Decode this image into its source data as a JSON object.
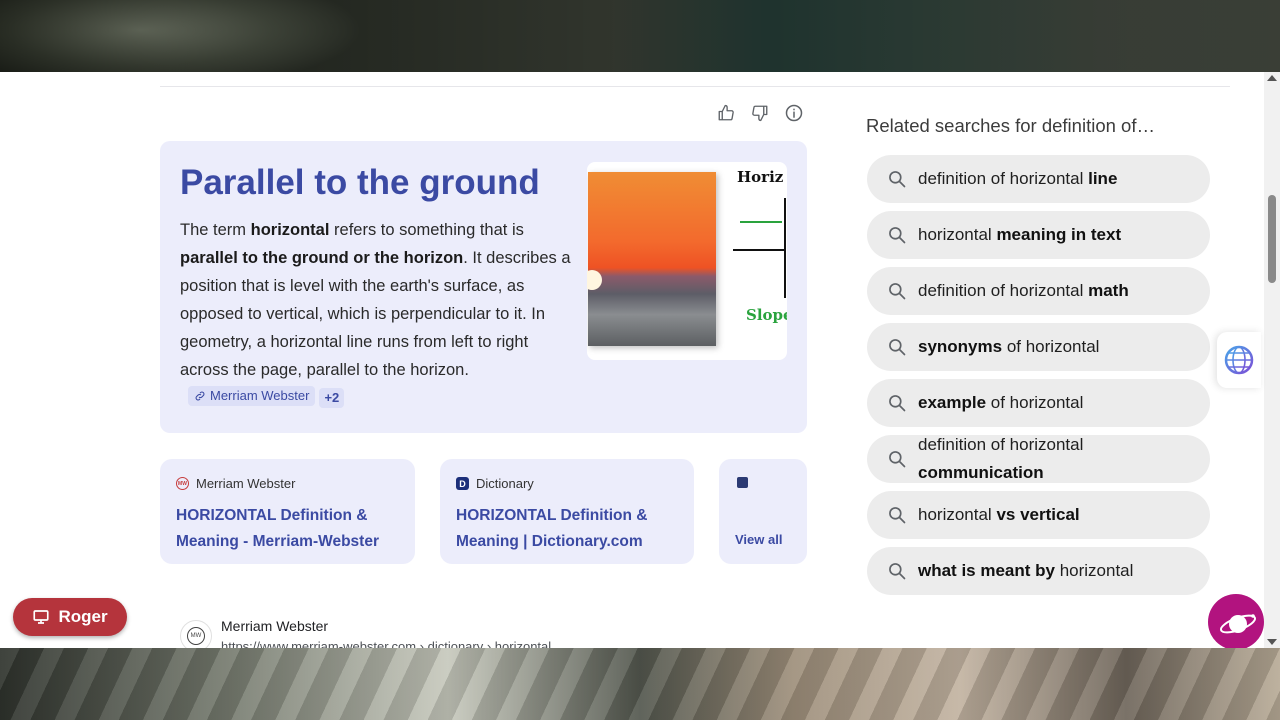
{
  "answer": {
    "title": "Parallel to the ground",
    "text_segments": [
      {
        "t": "The term ",
        "b": false
      },
      {
        "t": "horizontal",
        "b": true
      },
      {
        "t": " refers to something that is ",
        "b": false
      },
      {
        "t": "parallel to the ground or the horizon",
        "b": true
      },
      {
        "t": ". It describes a position that is level with the earth's surface, as opposed to vertical, which is perpendicular to it. In geometry, a horizontal line runs from left to right across the page, parallel to the horizon.",
        "b": false
      }
    ],
    "source_chip": "Merriam Webster",
    "more_chip": "+2",
    "image_diagram_title": "Horiz",
    "image_diagram_label": "Slope"
  },
  "feedback": {
    "icons": [
      "thumbs-up-icon",
      "thumbs-down-icon",
      "more-info-icon"
    ]
  },
  "sources": [
    {
      "site": "Merriam Webster",
      "title": "HORIZONTAL Definition & Meaning - Merriam-Webster"
    },
    {
      "site": "Dictionary",
      "title": "HORIZONTAL Definition & Meaning | Dictionary.com"
    },
    {
      "view_all": "View all"
    }
  ],
  "result": {
    "site": "Merriam Webster",
    "url": "https://www.merriam-webster.com › dictionary › horizontal"
  },
  "related": {
    "title": "Related searches for definition of…",
    "items": [
      [
        {
          "t": "definition of horizontal ",
          "b": false
        },
        {
          "t": "line",
          "b": true
        }
      ],
      [
        {
          "t": "horizontal ",
          "b": false
        },
        {
          "t": "meaning in text",
          "b": true
        }
      ],
      [
        {
          "t": "definition of horizontal ",
          "b": false
        },
        {
          "t": "math",
          "b": true
        }
      ],
      [
        {
          "t": "synonyms",
          "b": true
        },
        {
          "t": " of horizontal",
          "b": false
        }
      ],
      [
        {
          "t": "example",
          "b": true
        },
        {
          "t": " of horizontal",
          "b": false
        }
      ],
      [
        {
          "t": "definition of horizontal ",
          "b": false
        },
        {
          "t": "communication",
          "b": true
        }
      ],
      [
        {
          "t": "horizontal ",
          "b": false
        },
        {
          "t": "vs",
          "b": true
        },
        {
          "t": " ",
          "b": false
        },
        {
          "t": "vertical",
          "b": true
        }
      ],
      [
        {
          "t": "what is meant by",
          "b": true
        },
        {
          "t": " horizontal",
          "b": false
        }
      ]
    ]
  },
  "profile_button": {
    "label": "Roger"
  },
  "colors": {
    "accent": "#3b4aa3",
    "card_bg": "#ecedfb",
    "profile": "#b5343c",
    "ai_corner": "#b2137f"
  }
}
